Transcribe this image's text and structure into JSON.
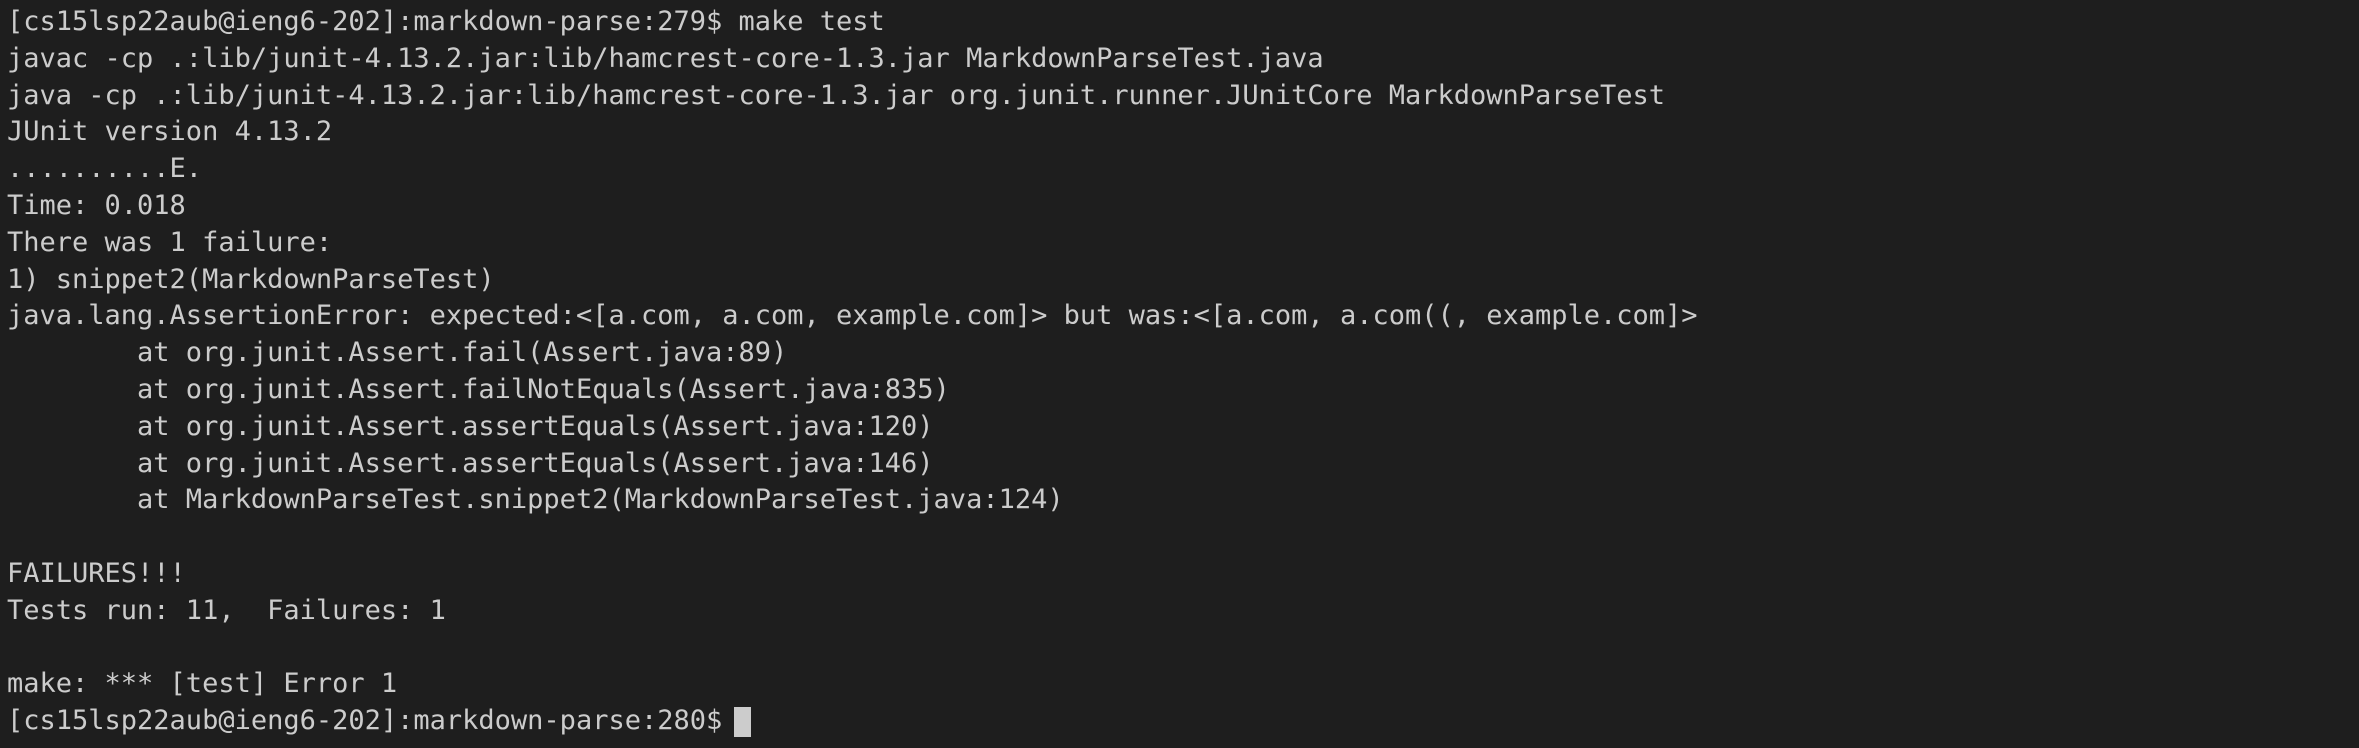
{
  "terminal": {
    "lines": [
      "[cs15lsp22aub@ieng6-202]:markdown-parse:279$ make test",
      "javac -cp .:lib/junit-4.13.2.jar:lib/hamcrest-core-1.3.jar MarkdownParseTest.java",
      "java -cp .:lib/junit-4.13.2.jar:lib/hamcrest-core-1.3.jar org.junit.runner.JUnitCore MarkdownParseTest",
      "JUnit version 4.13.2",
      "..........E.",
      "Time: 0.018",
      "There was 1 failure:",
      "1) snippet2(MarkdownParseTest)",
      "java.lang.AssertionError: expected:<[a.com, a.com, example.com]> but was:<[a.com, a.com((, example.com]>",
      "        at org.junit.Assert.fail(Assert.java:89)",
      "        at org.junit.Assert.failNotEquals(Assert.java:835)",
      "        at org.junit.Assert.assertEquals(Assert.java:120)",
      "        at org.junit.Assert.assertEquals(Assert.java:146)",
      "        at MarkdownParseTest.snippet2(MarkdownParseTest.java:124)",
      "",
      "FAILURES!!!",
      "Tests run: 11,  Failures: 1",
      "",
      "make: *** [test] Error 1"
    ],
    "prompt": "[cs15lsp22aub@ieng6-202]:markdown-parse:280$"
  }
}
